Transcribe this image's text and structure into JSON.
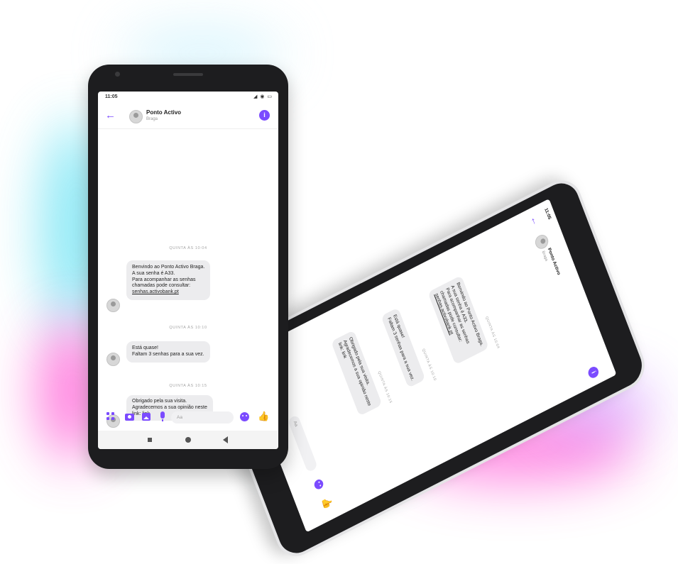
{
  "status": {
    "time": "11:05",
    "icons": "◢ ◉ ▭"
  },
  "chat": {
    "contact_name": "Ponto Activo",
    "contact_sub": "Braga",
    "avatar_label": "Nfrog"
  },
  "messages": [
    {
      "date": "QUINTA ÀS 10:04",
      "lines": [
        "Benvindo ao Ponto Activo Braga.",
        "A sua senha é A33.",
        "Para acompanhar as senhas",
        "chamadas pode consultar:"
      ],
      "link": "senhas.activobank.pt"
    },
    {
      "date": "QUINTA ÀS 10:10",
      "lines": [
        "Está quase!",
        "Faltam 3 senhas para a sua vez."
      ],
      "link": ""
    },
    {
      "date": "QUINTA ÀS 10:15",
      "lines": [
        "Obrigado pela sua visita.",
        "Agradecemos a sua opinião neste"
      ],
      "link_prefix": "link: ",
      "link": "link"
    }
  ],
  "composer": {
    "placeholder": "Aa"
  },
  "tilted": {
    "contact_name": "Ponto Activo",
    "contact_sub": "Braga",
    "messages": [
      {
        "date": "QUINTA ÀS 10:04",
        "lines": [
          "Benvindo ao Ponto Activo Braga.",
          "A sua senha é A33.",
          "Para acompanhar as senhas",
          "chamadas pode consultar:",
          "senhas.activobank.pt"
        ]
      },
      {
        "date": "QUINTA ÀS 10:10",
        "lines": [
          "Está quase!",
          "Faltam 3 senhas para a sua vez."
        ]
      },
      {
        "date": "QUINTA ÀS 10:15",
        "lines": [
          "Obrigado pela sua visita.",
          "Agradecemos a sua opinião neste",
          "link: link"
        ]
      }
    ],
    "placeholder": "Aa"
  },
  "colors": {
    "accent": "#7b4bff",
    "bubble": "#ececee"
  }
}
